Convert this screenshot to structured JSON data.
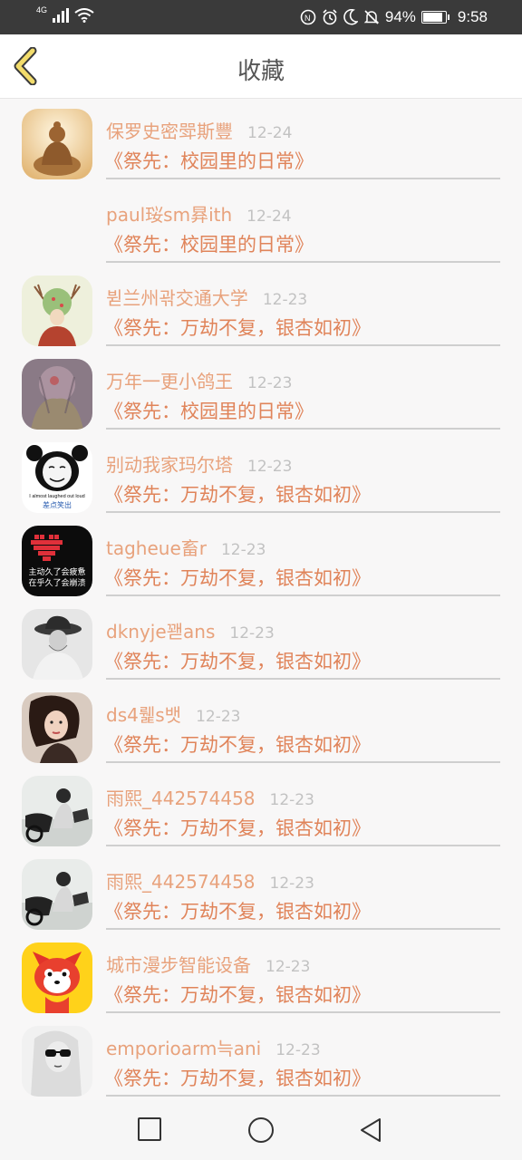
{
  "status_bar": {
    "network": "4G",
    "battery_text": "94%",
    "battery_level": 0.94,
    "time": "9:58",
    "icons": [
      "signal-icon",
      "wifi-icon",
      "nfc-icon",
      "alarm-icon",
      "moon-icon",
      "mute-bell-icon",
      "battery-icon"
    ]
  },
  "header": {
    "title": "收藏",
    "back_icon": "chevron-left-icon"
  },
  "colors": {
    "accent": "#e8a27c",
    "accent_dark": "#e0845a",
    "back_arrow_fill": "#f2dc6b",
    "date_gray": "#c2c2c2"
  },
  "items": [
    {
      "name": "保罗史密斝斯豐",
      "date": "12-24",
      "work": "《祭先：校园里的日常》",
      "avatar": "buddha-statue"
    },
    {
      "name": "paul珱sm昪ith",
      "date": "12-24",
      "work": "《祭先：校园里的日常》",
      "avatar": "none"
    },
    {
      "name": "뷛兰州곾交通大学",
      "date": "12-23",
      "work": "《祭先：万劫不复，银杏如初》",
      "avatar": "deer-girl-illustration"
    },
    {
      "name": "万年一更小鸽王",
      "date": "12-23",
      "work": "《祭先：校园里的日常》",
      "avatar": "deity-painting"
    },
    {
      "name": "别动我家玛尔塔",
      "date": "12-23",
      "work": "《祭先：万劫不复，银杏如初》",
      "avatar": "panda-meme",
      "avatar_text": [
        "I almost laughed out loud",
        "差点笑出"
      ]
    },
    {
      "name": "tagheue畜r",
      "date": "12-23",
      "work": "《祭先：万劫不复，银杏如初》",
      "avatar": "heart-text-card",
      "avatar_text": [
        "主动久了会疲惫",
        "在乎久了会崩溃"
      ]
    },
    {
      "name": "dknyje꽫ans",
      "date": "12-23",
      "work": "《祭先：万劫不复，银杏如初》",
      "avatar": "woman-in-hat"
    },
    {
      "name": "ds4뤭s뱃",
      "date": "12-23",
      "work": "《祭先：万劫不复，银杏如初》",
      "avatar": "woman-portrait"
    },
    {
      "name": "雨熙_442574458",
      "date": "12-23",
      "work": "《祭先：万劫不复，银杏如初》",
      "avatar": "person-with-motorbike"
    },
    {
      "name": "雨熙_442574458",
      "date": "12-23",
      "work": "《祭先：万劫不复，银杏如初》",
      "avatar": "person-with-motorbike"
    },
    {
      "name": "城市漫步智能设备",
      "date": "12-23",
      "work": "《祭先：万劫不复，银杏如初》",
      "avatar": "red-fox-cartoon"
    },
    {
      "name": "emporioarm늑ani",
      "date": "12-23",
      "work": "《祭先：万劫不复，银杏如初》",
      "avatar": "woman-sunglasses"
    }
  ],
  "nav_bar": {
    "buttons": [
      "recent-apps-square-icon",
      "home-circle-icon",
      "back-triangle-icon"
    ]
  }
}
